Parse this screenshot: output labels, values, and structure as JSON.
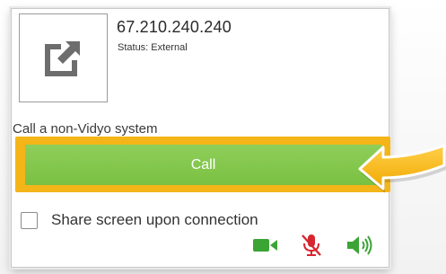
{
  "contact": {
    "name": "67.210.240.240",
    "status": "Status: External",
    "avatar_icon": "external-link-icon"
  },
  "hint_text": "Call a non-Vidyo system",
  "call_button": {
    "label": "Call"
  },
  "share_screen": {
    "label": "Share screen upon connection",
    "checked": false
  },
  "media_controls": [
    {
      "name": "camera-icon",
      "state": "on"
    },
    {
      "name": "microphone-muted-icon",
      "state": "muted"
    },
    {
      "name": "speaker-icon",
      "state": "on"
    }
  ],
  "colors": {
    "call_button": "#7ac142",
    "highlight_frame": "#f4b518",
    "media_on": "#3aa435",
    "media_muted": "#d7262f",
    "pointer_arrow": "#f4b518"
  }
}
